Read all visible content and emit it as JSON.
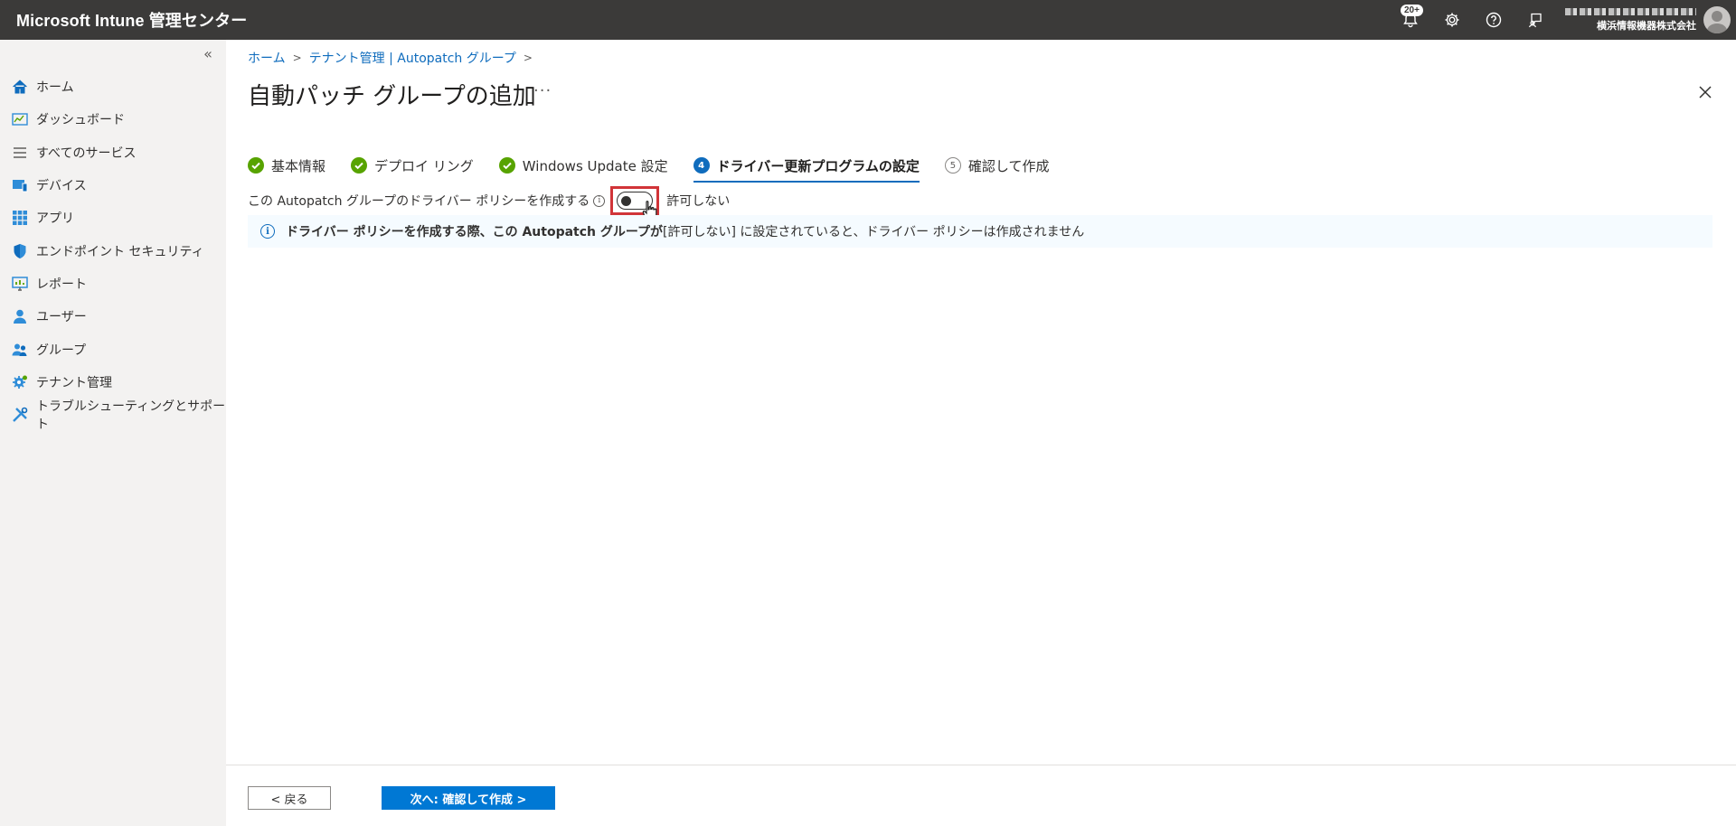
{
  "app": {
    "title": "Microsoft Intune 管理センター"
  },
  "topbar": {
    "notification_badge": "20+",
    "org_name": "横浜情報機器株式会社"
  },
  "sidebar": {
    "collapse_label": "«",
    "items": [
      {
        "label": "ホーム",
        "icon": "home-icon"
      },
      {
        "label": "ダッシュボード",
        "icon": "dashboard-icon"
      },
      {
        "label": "すべてのサービス",
        "icon": "list-icon"
      },
      {
        "label": "デバイス",
        "icon": "device-icon"
      },
      {
        "label": "アプリ",
        "icon": "apps-grid-icon"
      },
      {
        "label": "エンドポイント セキュリティ",
        "icon": "shield-icon"
      },
      {
        "label": "レポート",
        "icon": "report-icon"
      },
      {
        "label": "ユーザー",
        "icon": "user-icon"
      },
      {
        "label": "グループ",
        "icon": "group-icon"
      },
      {
        "label": "テナント管理",
        "icon": "tenant-gear-icon"
      },
      {
        "label": "トラブルシューティングとサポート",
        "icon": "tools-icon"
      }
    ]
  },
  "breadcrumb": {
    "home": "ホーム",
    "tenant": "テナント管理 | Autopatch グループ"
  },
  "page": {
    "title": "自動パッチ グループの追加",
    "more": "···"
  },
  "tabs": [
    {
      "label": "基本情報",
      "state": "done",
      "num": ""
    },
    {
      "label": "デプロイ リング",
      "state": "done",
      "num": ""
    },
    {
      "label": "Windows Update 設定",
      "state": "done",
      "num": ""
    },
    {
      "label": "ドライバー更新プログラムの設定",
      "state": "current",
      "num": "4"
    },
    {
      "label": "確認して作成",
      "state": "todo",
      "num": "5"
    }
  ],
  "policy": {
    "label": "この Autopatch グループのドライバー ポリシーを作成する",
    "info_icon": "i",
    "toggle_state": "許可しない"
  },
  "info_bar": {
    "icon": "i",
    "bold_text": "ドライバー ポリシーを作成する際、この Autopatch グループが",
    "normal_text": " [許可しない] に設定されていると、ドライバー ポリシーは作成されません"
  },
  "footer": {
    "back_label": "< 戻る",
    "next_label": "次へ: 確認して作成 >"
  },
  "colors": {
    "topbar": "#3b3a39",
    "accent": "#0078d4",
    "done": "#57a300",
    "highlight": "#d13438"
  }
}
